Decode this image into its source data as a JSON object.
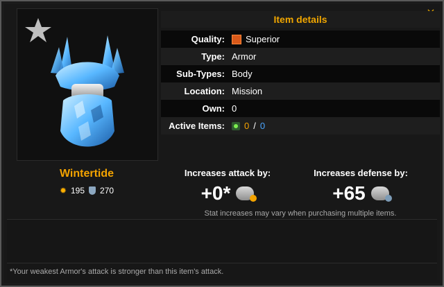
{
  "header": {
    "title": "Item details"
  },
  "details": {
    "quality_label": "Quality:",
    "quality_value": "Superior",
    "type_label": "Type:",
    "type_value": "Armor",
    "subtypes_label": "Sub-Types:",
    "subtypes_value": "Body",
    "location_label": "Location:",
    "location_value": "Mission",
    "own_label": "Own:",
    "own_value": "0",
    "active_label": "Active Items:",
    "active_value": "0",
    "active_sep": "/",
    "active_total": "0"
  },
  "item": {
    "name": "Wintertide",
    "attack": "195",
    "defense": "270"
  },
  "bonus": {
    "attack_label": "Increases attack by:",
    "attack_value": "+0*",
    "defense_label": "Increases defense by:",
    "defense_value": "+65",
    "note": "Stat increases may vary when purchasing multiple items."
  },
  "footer": {
    "text": "*Your weakest Armor's attack is stronger than this item's attack."
  },
  "colors": {
    "accent": "#f3a300",
    "blue": "#4aa5ff"
  },
  "icons": {
    "close": "close-icon",
    "star": "star-icon",
    "quality": "quality-gem-icon",
    "active": "active-items-icon",
    "attack": "attack-icon",
    "defense": "defense-icon"
  }
}
